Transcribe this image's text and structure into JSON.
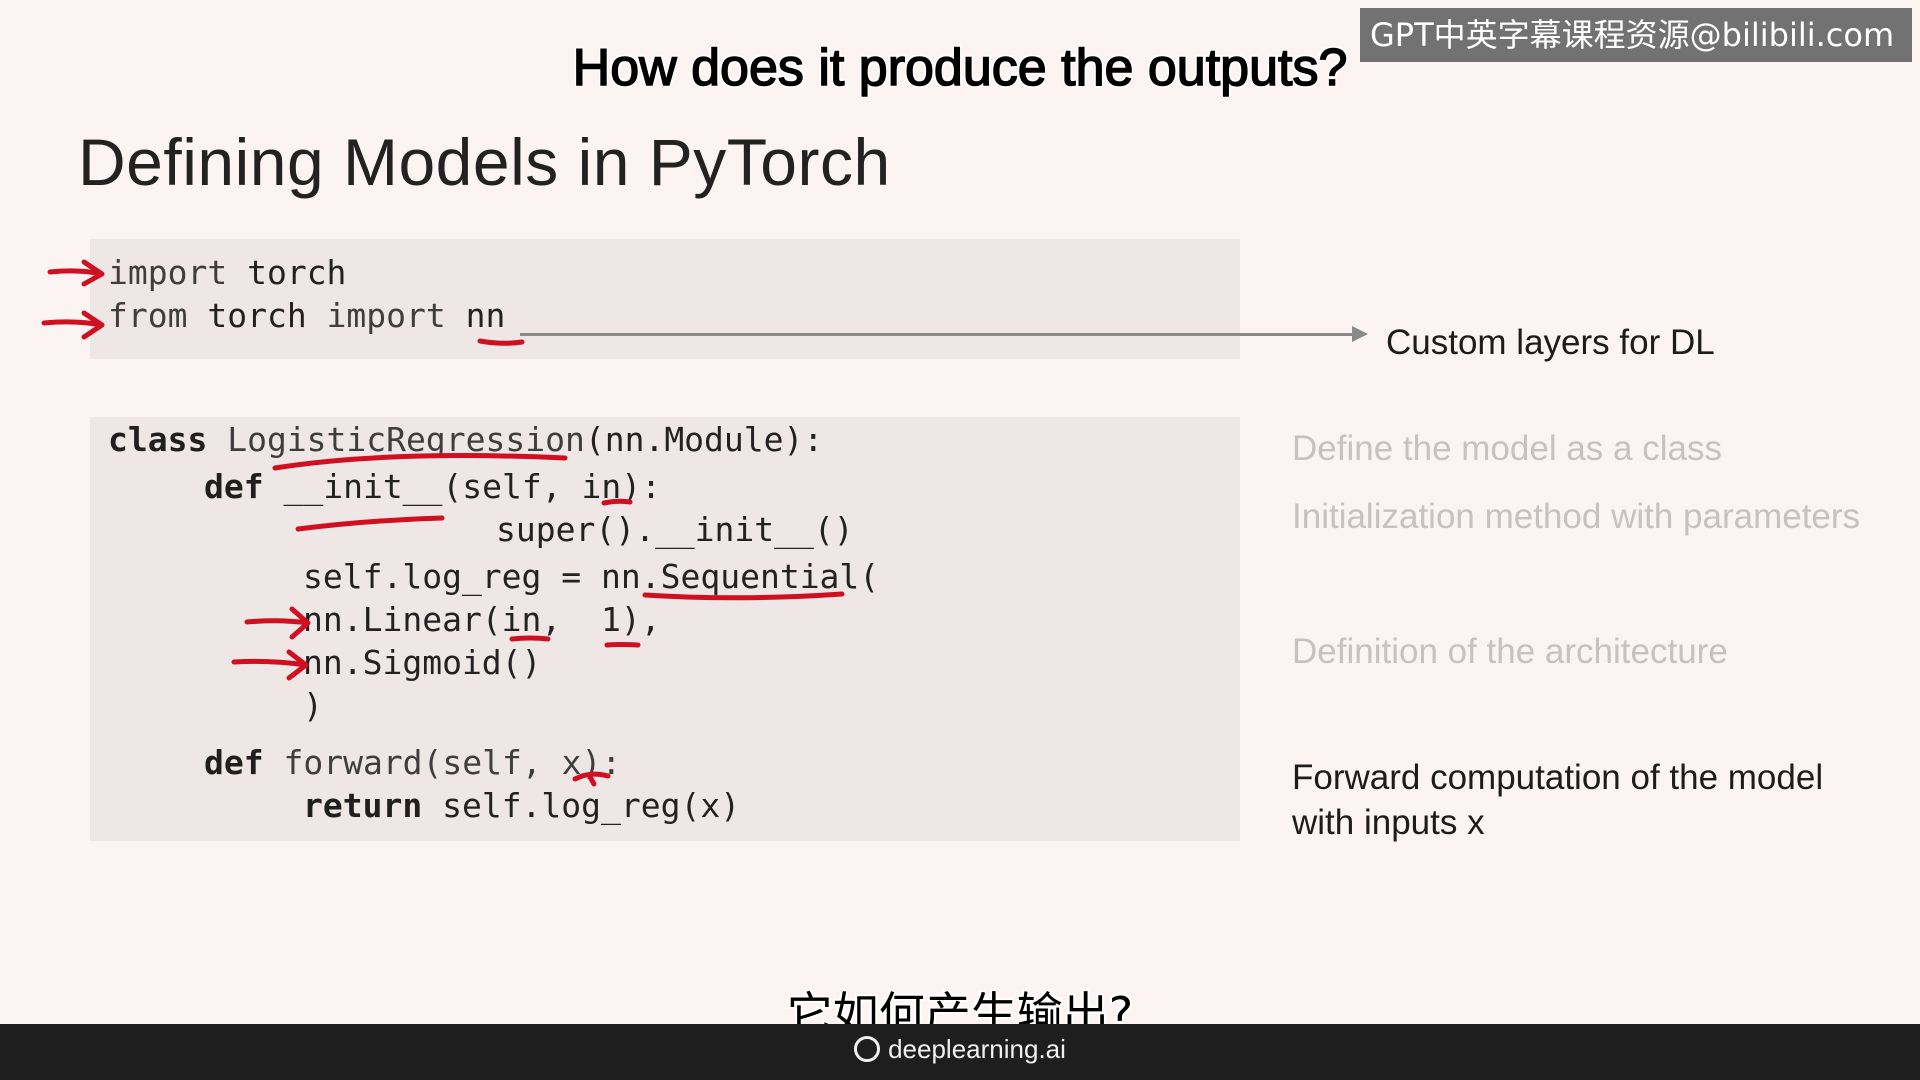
{
  "subtitles": {
    "english": "How does it produce the outputs?",
    "chinese": "它如何产生输出?"
  },
  "watermark": "GPT中英字幕课程资源@bilibili.com",
  "slide": {
    "title": "Defining Models in PyTorch",
    "imports": {
      "line1_kw": "import",
      "line1_rest": " torch",
      "line2_kw": "from",
      "line2_mid": " torch ",
      "line2_kw2": "import",
      "line2_rest": " nn"
    },
    "class_code": {
      "class_kw": "class",
      "class_name": " LogisticRegression",
      "class_rest": "(nn.Module):",
      "def_kw": "def",
      "init_sig": " __init__(self, in):",
      "super_call": "super().__init__()",
      "seq_line": "self.log_reg = nn.Sequential(",
      "linear_line": "nn.Linear(in,  1),",
      "sigmoid_line": "nn.Sigmoid()",
      "close_paren": ")",
      "def_kw2": "def",
      "forward_sig": " forward(self, x):",
      "return_kw": "return",
      "return_rest": " self.log_reg(x)"
    },
    "notes": {
      "custom_layers": "Custom layers for DL",
      "define_class": "Define the model as a class",
      "init_method": "Initialization method with parameters",
      "architecture": "Definition of the architecture",
      "forward_line1": "Forward computation of the model",
      "forward_line2": "with inputs x"
    }
  },
  "footer": {
    "brand": "deeplearning.ai"
  },
  "colors": {
    "annotation": "#d01020",
    "background": "#fcf3f3",
    "code_box": "#efe6e6"
  }
}
